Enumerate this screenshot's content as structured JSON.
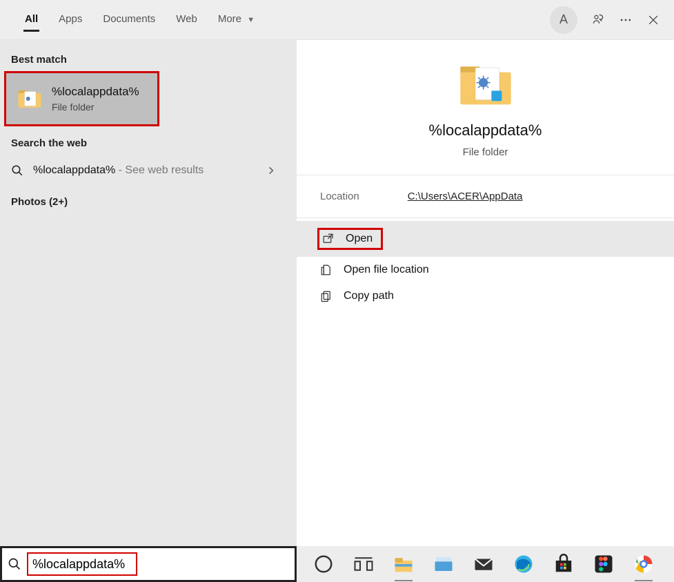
{
  "header": {
    "tabs": {
      "all": "All",
      "apps": "Apps",
      "documents": "Documents",
      "web": "Web",
      "more": "More"
    },
    "avatar_initial": "A"
  },
  "left": {
    "best_match_header": "Best match",
    "best_match": {
      "title": "%localappdata%",
      "subtitle": "File folder"
    },
    "search_web_header": "Search the web",
    "web_query": "%localappdata%",
    "web_suffix": " - See web results",
    "photos_label": "Photos (2+)"
  },
  "detail": {
    "title": "%localappdata%",
    "subtitle": "File folder",
    "location_label": "Location",
    "location_value": "C:\\Users\\ACER\\AppData",
    "actions": {
      "open": "Open",
      "open_file_location": "Open file location",
      "copy_path": "Copy path"
    }
  },
  "search": {
    "value": "%localappdata%"
  }
}
